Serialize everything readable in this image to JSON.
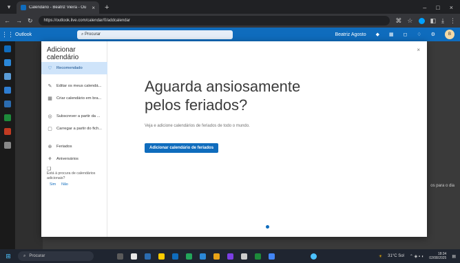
{
  "browser": {
    "tab_title": "Calendário - Beatriz Vieira - Ou",
    "tab_close": "×",
    "new_tab": "+",
    "url": "https://outlook.live.com/calendar/0/addcalendar",
    "min": "–",
    "max": "□",
    "close": "×"
  },
  "outlook": {
    "brand": "Outlook",
    "search_placeholder": "Procurar",
    "user_name": "Beatriz Agosto"
  },
  "modal": {
    "title": "Adicionar calendário",
    "close": "×",
    "nav": {
      "recommended": "Recomendado",
      "edit_calendars": "Editar os meus calendá...",
      "create_blank": "Criar calendário em bra...",
      "subscribe_web": "Subscrever a partir da ...",
      "upload_file": "Carregar a partir do fich...",
      "holidays": "Feriados",
      "birthdays": "Aniversários"
    },
    "hint": {
      "question": "Está à procura de calendários adicionais?",
      "yes": "Sim",
      "no": "Não"
    },
    "content": {
      "heading_line1": "Aguarda ansiosamente",
      "heading_line2": "pelos feriados?",
      "subtitle": "Veja e adicione calendários de feriados de todo o mundo.",
      "button": "Adicionar calendário de feriados"
    }
  },
  "background": {
    "right_text": "os para o dia"
  },
  "taskbar": {
    "search_placeholder": "Procurar",
    "weather": "31°C Sol",
    "time": "18:34",
    "date": "02/08/2025"
  },
  "colors": {
    "accent": "#0f6cbd",
    "selected_nav": "#cfe4fa",
    "taskbar": "#1f2530"
  }
}
